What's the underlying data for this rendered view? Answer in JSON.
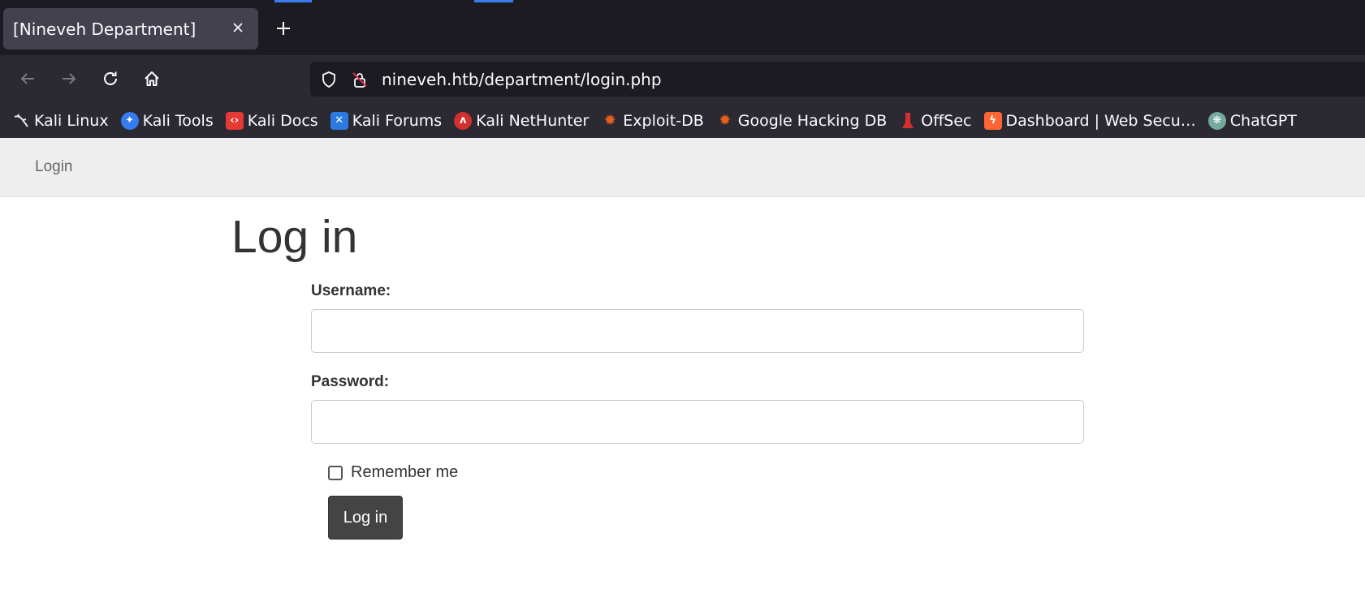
{
  "browser": {
    "tab": {
      "title": "[Nineveh Department]",
      "close_icon": "close-icon"
    },
    "new_tab_icon": "plus-icon",
    "nav": {
      "back_icon": "arrow-left-icon",
      "forward_icon": "arrow-right-icon",
      "reload_icon": "reload-icon",
      "home_icon": "home-icon"
    },
    "urlbar": {
      "url": "nineveh.htb/department/login.php",
      "shield_icon": "shield-icon",
      "lock_icon": "insecure-lock-icon"
    },
    "bookmarks": [
      {
        "label": "Kali Linux",
        "icon": "kali-dragon-icon",
        "color": "#222222"
      },
      {
        "label": "Kali Tools",
        "icon": "kali-tools-icon",
        "color": "#367bf0"
      },
      {
        "label": "Kali Docs",
        "icon": "kali-docs-icon",
        "color": "#e53935"
      },
      {
        "label": "Kali Forums",
        "icon": "kali-forums-icon",
        "color": "#2a7ae2"
      },
      {
        "label": "Kali NetHunter",
        "icon": "nethunter-icon",
        "color": "#d32f2f"
      },
      {
        "label": "Exploit-DB",
        "icon": "exploit-db-icon",
        "color": "#e8601c"
      },
      {
        "label": "Google Hacking DB",
        "icon": "ghdb-icon",
        "color": "#e8601c"
      },
      {
        "label": "OffSec",
        "icon": "offsec-icon",
        "color": "#d32f2f"
      },
      {
        "label": "Dashboard | Web Secu…",
        "icon": "portswigger-icon",
        "color": "#ff6633"
      },
      {
        "label": "ChatGPT",
        "icon": "chatgpt-icon",
        "color": "#74aa9c"
      }
    ]
  },
  "page": {
    "nav": {
      "login_link": "Login"
    },
    "title": "Log in",
    "form": {
      "username_label": "Username:",
      "username_value": "",
      "password_label": "Password:",
      "password_value": "",
      "remember_label": "Remember me",
      "remember_checked": false,
      "submit_label": "Log in"
    }
  },
  "colors": {
    "tabstrip_bg": "#1c1b22",
    "toolbar_bg": "#2b2a33",
    "active_tab_bg": "#42414d",
    "accent": "#3c7cf1",
    "site_nav_bg": "#eeeeee",
    "button_bg": "#444444"
  }
}
